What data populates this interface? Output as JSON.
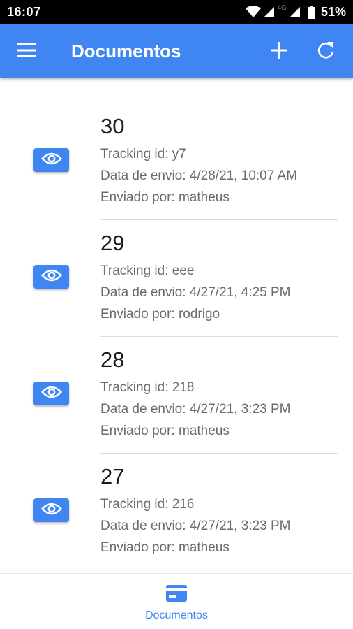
{
  "status_bar": {
    "time": "16:07",
    "network": "4G",
    "battery": "51%",
    "icons": [
      "wifi-icon",
      "signal-icon",
      "signal-icon",
      "battery-icon"
    ]
  },
  "app_bar": {
    "title": "Documentos",
    "color": "#3f86f2",
    "icons": [
      "menu-icon",
      "add-icon",
      "refresh-icon"
    ]
  },
  "documents": [
    {
      "number": "30",
      "tracking": "Tracking id: y7",
      "date": "Data de envio: 4/28/21, 10:07 AM",
      "sender": "Enviado por: matheus"
    },
    {
      "number": "29",
      "tracking": "Tracking id: eee",
      "date": "Data de envio: 4/27/21, 4:25 PM",
      "sender": "Enviado por: rodrigo"
    },
    {
      "number": "28",
      "tracking": "Tracking id: 218",
      "date": "Data de envio: 4/27/21, 3:23 PM",
      "sender": "Enviado por: matheus"
    },
    {
      "number": "27",
      "tracking": "Tracking id: 216",
      "date": "Data de envio: 4/27/21, 3:23 PM",
      "sender": "Enviado por: matheus"
    }
  ],
  "bottom_nav": {
    "tabs": [
      {
        "label": "Documentos",
        "icon": "card-icon",
        "active": true
      }
    ]
  }
}
